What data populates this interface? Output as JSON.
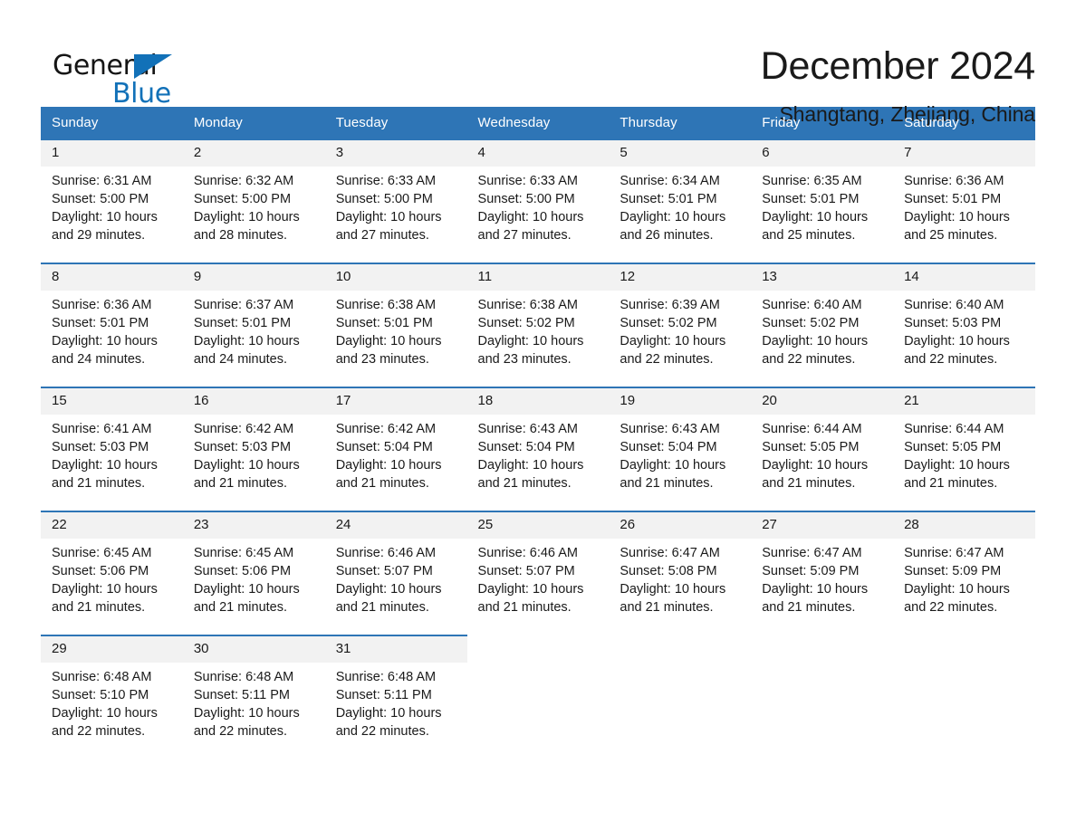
{
  "brand": {
    "name_part1": "General",
    "name_part2": "Blue",
    "accent_color": "#1271b8"
  },
  "header": {
    "month_title": "December 2024",
    "location": "Shangtang, Zhejiang, China",
    "header_bg_color": "#2e75b6",
    "daynum_bg_color": "#f2f2f2"
  },
  "weekday_headers": [
    "Sunday",
    "Monday",
    "Tuesday",
    "Wednesday",
    "Thursday",
    "Friday",
    "Saturday"
  ],
  "labels": {
    "sunrise_prefix": "Sunrise:",
    "sunset_prefix": "Sunset:",
    "daylight_prefix": "Daylight:"
  },
  "weeks": [
    [
      {
        "day": "1",
        "sunrise": "Sunrise: 6:31 AM",
        "sunset": "Sunset: 5:00 PM",
        "daylight_line1": "Daylight: 10 hours",
        "daylight_line2": "and 29 minutes."
      },
      {
        "day": "2",
        "sunrise": "Sunrise: 6:32 AM",
        "sunset": "Sunset: 5:00 PM",
        "daylight_line1": "Daylight: 10 hours",
        "daylight_line2": "and 28 minutes."
      },
      {
        "day": "3",
        "sunrise": "Sunrise: 6:33 AM",
        "sunset": "Sunset: 5:00 PM",
        "daylight_line1": "Daylight: 10 hours",
        "daylight_line2": "and 27 minutes."
      },
      {
        "day": "4",
        "sunrise": "Sunrise: 6:33 AM",
        "sunset": "Sunset: 5:00 PM",
        "daylight_line1": "Daylight: 10 hours",
        "daylight_line2": "and 27 minutes."
      },
      {
        "day": "5",
        "sunrise": "Sunrise: 6:34 AM",
        "sunset": "Sunset: 5:01 PM",
        "daylight_line1": "Daylight: 10 hours",
        "daylight_line2": "and 26 minutes."
      },
      {
        "day": "6",
        "sunrise": "Sunrise: 6:35 AM",
        "sunset": "Sunset: 5:01 PM",
        "daylight_line1": "Daylight: 10 hours",
        "daylight_line2": "and 25 minutes."
      },
      {
        "day": "7",
        "sunrise": "Sunrise: 6:36 AM",
        "sunset": "Sunset: 5:01 PM",
        "daylight_line1": "Daylight: 10 hours",
        "daylight_line2": "and 25 minutes."
      }
    ],
    [
      {
        "day": "8",
        "sunrise": "Sunrise: 6:36 AM",
        "sunset": "Sunset: 5:01 PM",
        "daylight_line1": "Daylight: 10 hours",
        "daylight_line2": "and 24 minutes."
      },
      {
        "day": "9",
        "sunrise": "Sunrise: 6:37 AM",
        "sunset": "Sunset: 5:01 PM",
        "daylight_line1": "Daylight: 10 hours",
        "daylight_line2": "and 24 minutes."
      },
      {
        "day": "10",
        "sunrise": "Sunrise: 6:38 AM",
        "sunset": "Sunset: 5:01 PM",
        "daylight_line1": "Daylight: 10 hours",
        "daylight_line2": "and 23 minutes."
      },
      {
        "day": "11",
        "sunrise": "Sunrise: 6:38 AM",
        "sunset": "Sunset: 5:02 PM",
        "daylight_line1": "Daylight: 10 hours",
        "daylight_line2": "and 23 minutes."
      },
      {
        "day": "12",
        "sunrise": "Sunrise: 6:39 AM",
        "sunset": "Sunset: 5:02 PM",
        "daylight_line1": "Daylight: 10 hours",
        "daylight_line2": "and 22 minutes."
      },
      {
        "day": "13",
        "sunrise": "Sunrise: 6:40 AM",
        "sunset": "Sunset: 5:02 PM",
        "daylight_line1": "Daylight: 10 hours",
        "daylight_line2": "and 22 minutes."
      },
      {
        "day": "14",
        "sunrise": "Sunrise: 6:40 AM",
        "sunset": "Sunset: 5:03 PM",
        "daylight_line1": "Daylight: 10 hours",
        "daylight_line2": "and 22 minutes."
      }
    ],
    [
      {
        "day": "15",
        "sunrise": "Sunrise: 6:41 AM",
        "sunset": "Sunset: 5:03 PM",
        "daylight_line1": "Daylight: 10 hours",
        "daylight_line2": "and 21 minutes."
      },
      {
        "day": "16",
        "sunrise": "Sunrise: 6:42 AM",
        "sunset": "Sunset: 5:03 PM",
        "daylight_line1": "Daylight: 10 hours",
        "daylight_line2": "and 21 minutes."
      },
      {
        "day": "17",
        "sunrise": "Sunrise: 6:42 AM",
        "sunset": "Sunset: 5:04 PM",
        "daylight_line1": "Daylight: 10 hours",
        "daylight_line2": "and 21 minutes."
      },
      {
        "day": "18",
        "sunrise": "Sunrise: 6:43 AM",
        "sunset": "Sunset: 5:04 PM",
        "daylight_line1": "Daylight: 10 hours",
        "daylight_line2": "and 21 minutes."
      },
      {
        "day": "19",
        "sunrise": "Sunrise: 6:43 AM",
        "sunset": "Sunset: 5:04 PM",
        "daylight_line1": "Daylight: 10 hours",
        "daylight_line2": "and 21 minutes."
      },
      {
        "day": "20",
        "sunrise": "Sunrise: 6:44 AM",
        "sunset": "Sunset: 5:05 PM",
        "daylight_line1": "Daylight: 10 hours",
        "daylight_line2": "and 21 minutes."
      },
      {
        "day": "21",
        "sunrise": "Sunrise: 6:44 AM",
        "sunset": "Sunset: 5:05 PM",
        "daylight_line1": "Daylight: 10 hours",
        "daylight_line2": "and 21 minutes."
      }
    ],
    [
      {
        "day": "22",
        "sunrise": "Sunrise: 6:45 AM",
        "sunset": "Sunset: 5:06 PM",
        "daylight_line1": "Daylight: 10 hours",
        "daylight_line2": "and 21 minutes."
      },
      {
        "day": "23",
        "sunrise": "Sunrise: 6:45 AM",
        "sunset": "Sunset: 5:06 PM",
        "daylight_line1": "Daylight: 10 hours",
        "daylight_line2": "and 21 minutes."
      },
      {
        "day": "24",
        "sunrise": "Sunrise: 6:46 AM",
        "sunset": "Sunset: 5:07 PM",
        "daylight_line1": "Daylight: 10 hours",
        "daylight_line2": "and 21 minutes."
      },
      {
        "day": "25",
        "sunrise": "Sunrise: 6:46 AM",
        "sunset": "Sunset: 5:07 PM",
        "daylight_line1": "Daylight: 10 hours",
        "daylight_line2": "and 21 minutes."
      },
      {
        "day": "26",
        "sunrise": "Sunrise: 6:47 AM",
        "sunset": "Sunset: 5:08 PM",
        "daylight_line1": "Daylight: 10 hours",
        "daylight_line2": "and 21 minutes."
      },
      {
        "day": "27",
        "sunrise": "Sunrise: 6:47 AM",
        "sunset": "Sunset: 5:09 PM",
        "daylight_line1": "Daylight: 10 hours",
        "daylight_line2": "and 21 minutes."
      },
      {
        "day": "28",
        "sunrise": "Sunrise: 6:47 AM",
        "sunset": "Sunset: 5:09 PM",
        "daylight_line1": "Daylight: 10 hours",
        "daylight_line2": "and 22 minutes."
      }
    ],
    [
      {
        "day": "29",
        "sunrise": "Sunrise: 6:48 AM",
        "sunset": "Sunset: 5:10 PM",
        "daylight_line1": "Daylight: 10 hours",
        "daylight_line2": "and 22 minutes."
      },
      {
        "day": "30",
        "sunrise": "Sunrise: 6:48 AM",
        "sunset": "Sunset: 5:11 PM",
        "daylight_line1": "Daylight: 10 hours",
        "daylight_line2": "and 22 minutes."
      },
      {
        "day": "31",
        "sunrise": "Sunrise: 6:48 AM",
        "sunset": "Sunset: 5:11 PM",
        "daylight_line1": "Daylight: 10 hours",
        "daylight_line2": "and 22 minutes."
      },
      {
        "day": "",
        "sunrise": "",
        "sunset": "",
        "daylight_line1": "",
        "daylight_line2": "",
        "empty": true
      },
      {
        "day": "",
        "sunrise": "",
        "sunset": "",
        "daylight_line1": "",
        "daylight_line2": "",
        "empty": true
      },
      {
        "day": "",
        "sunrise": "",
        "sunset": "",
        "daylight_line1": "",
        "daylight_line2": "",
        "empty": true
      },
      {
        "day": "",
        "sunrise": "",
        "sunset": "",
        "daylight_line1": "",
        "daylight_line2": "",
        "empty": true
      }
    ]
  ]
}
